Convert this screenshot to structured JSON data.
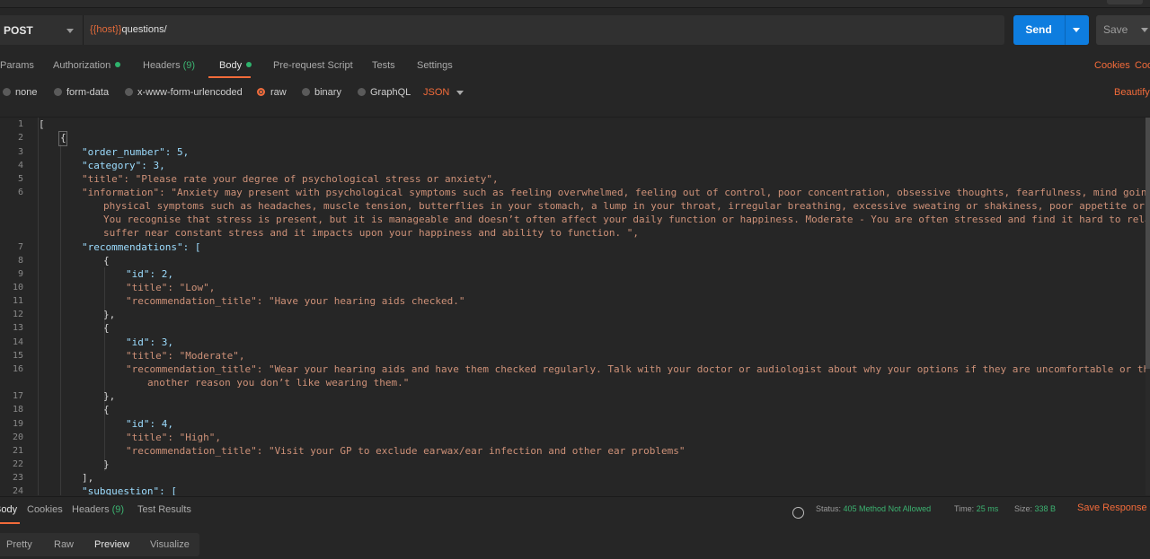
{
  "request": {
    "method": "POST",
    "url_var": "{{host}}",
    "url_path": "questions/",
    "send_label": "Send",
    "save_label": "Save"
  },
  "tabs": [
    {
      "label": "Params"
    },
    {
      "label": "Authorization"
    },
    {
      "label": "Headers",
      "count": "(9)"
    },
    {
      "label": "Body"
    },
    {
      "label": "Pre-request Script"
    },
    {
      "label": "Tests"
    },
    {
      "label": "Settings"
    }
  ],
  "right_links": {
    "cookies": "Cookies",
    "code": "Code"
  },
  "body_types": [
    "none",
    "form-data",
    "x-www-form-urlencoded",
    "raw",
    "binary",
    "GraphQL"
  ],
  "body_format": "JSON",
  "beautify_label": "Beautify",
  "code_lines": [
    "[",
    "{",
    "\"order_number\": 5,",
    "\"category\": 3,",
    "\"title\": \"Please rate your degree of psychological stress or anxiety\",",
    "\"information\": \"Anxiety may present with psychological symptoms such as feeling overwhelmed, feeling out of control, poor concentration, obsessive thoughts, fearfulness, mind going blank or",
    "physical symptoms such as headaches, muscle tension, butterflies in your stomach, a lump in your throat, irregular breathing, excessive sweating or shakiness, poor appetite or nausea.Low -",
    "You recognise that stress is present, but it is manageable and doesn’t often affect your daily function or happiness. Moderate - You are often stressed and find it hard to relax. High - You",
    "suffer near constant stress and it impacts upon your happiness and ability to function. \",",
    "\"recommendations\": [",
    "{",
    "\"id\": 2,",
    "\"title\": \"Low\",",
    "\"recommendation_title\": \"Have your hearing aids checked.\"",
    "},",
    "{",
    "\"id\": 3,",
    "\"title\": \"Moderate\",",
    "\"recommendation_title\": \"Wear your hearing aids and have them checked regularly. Talk with your doctor or audiologist about why your options if they are uncomfortable or there is",
    "another reason you don’t like wearing them.\"",
    "},",
    "{",
    "\"id\": 4,",
    "\"title\": \"High\",",
    "\"recommendation_title\": \"Visit your GP to exclude earwax/ear infection and other ear problems\"",
    "}",
    "],",
    "\"subquestion\": ["
  ],
  "line_numbers": [
    "1",
    "2",
    "3",
    "4",
    "5",
    "6",
    "7",
    "8",
    "9",
    "10",
    "11",
    "12",
    "13",
    "14",
    "15",
    "16",
    "17",
    "18",
    "19",
    "20",
    "21",
    "22",
    "23",
    "24"
  ],
  "response": {
    "tabs": [
      {
        "label": "Body"
      },
      {
        "label": "Cookies"
      },
      {
        "label": "Headers",
        "count": "(9)"
      },
      {
        "label": "Test Results"
      }
    ],
    "status_label": "Status:",
    "status_value": "405 Method Not Allowed",
    "time_label": "Time:",
    "time_value": "25 ms",
    "size_label": "Size:",
    "size_value": "338 B",
    "save_response": "Save Response",
    "view_tabs": [
      "Pretty",
      "Raw",
      "Preview",
      "Visualize"
    ]
  }
}
